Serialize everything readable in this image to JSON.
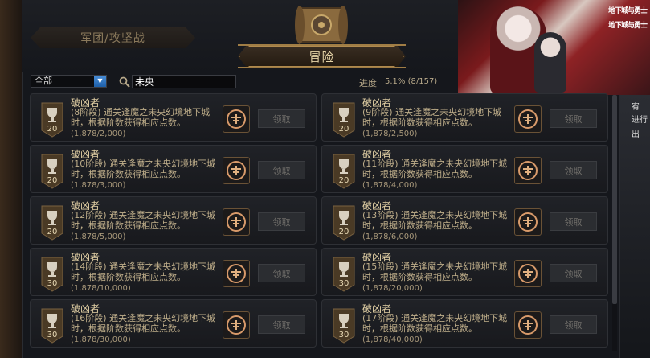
{
  "tabs": {
    "legion": "军团/攻坚战",
    "adventure": "冒险"
  },
  "filter": {
    "selected": "全部"
  },
  "search": {
    "value": "未央"
  },
  "progress": {
    "label": "进度",
    "value": "5.1% (8/157)"
  },
  "claim_label": "领取",
  "banner": {
    "logo1": "地下城与勇士",
    "logo2": "地下城与勇士"
  },
  "side": {
    "text1": "宥",
    "text2": "进行",
    "text3": "出"
  },
  "achievements": [
    {
      "title": "破凶者",
      "desc": "(8阶段) 通关逢魔之未央幻境地下城时，根据阶数获得相应点数。",
      "count": "(1,878/2,000)",
      "points": "20"
    },
    {
      "title": "破凶者",
      "desc": "(9阶段) 通关逢魔之未央幻境地下城时，根据阶数获得相应点数。",
      "count": "(1,878/2,500)",
      "points": "20"
    },
    {
      "title": "破凶者",
      "desc": "(10阶段) 通关逢魔之未央幻境地下城时，根据阶数获得相应点数。",
      "count": "(1,878/3,000)",
      "points": "20"
    },
    {
      "title": "破凶者",
      "desc": "(11阶段) 通关逢魔之未央幻境地下城时，根据阶数获得相应点数。",
      "count": "(1,878/4,000)",
      "points": "20"
    },
    {
      "title": "破凶者",
      "desc": "(12阶段) 通关逢魔之未央幻境地下城时，根据阶数获得相应点数。",
      "count": "(1,878/5,000)",
      "points": "20"
    },
    {
      "title": "破凶者",
      "desc": "(13阶段) 通关逢魔之未央幻境地下城时，根据阶数获得相应点数。",
      "count": "(1,878/6,000)",
      "points": "20"
    },
    {
      "title": "破凶者",
      "desc": "(14阶段) 通关逢魔之未央幻境地下城时，根据阶数获得相应点数。",
      "count": "(1,878/10,000)",
      "points": "30"
    },
    {
      "title": "破凶者",
      "desc": "(15阶段) 通关逢魔之未央幻境地下城时，根据阶数获得相应点数。",
      "count": "(1,878/20,000)",
      "points": "30"
    },
    {
      "title": "破凶者",
      "desc": "(16阶段) 通关逢魔之未央幻境地下城时，根据阶数获得相应点数。",
      "count": "(1,878/30,000)",
      "points": "30"
    },
    {
      "title": "破凶者",
      "desc": "(17阶段) 通关逢魔之未央幻境地下城时，根据阶数获得相应点数。",
      "count": "(1,878/40,000)",
      "points": "30"
    }
  ]
}
